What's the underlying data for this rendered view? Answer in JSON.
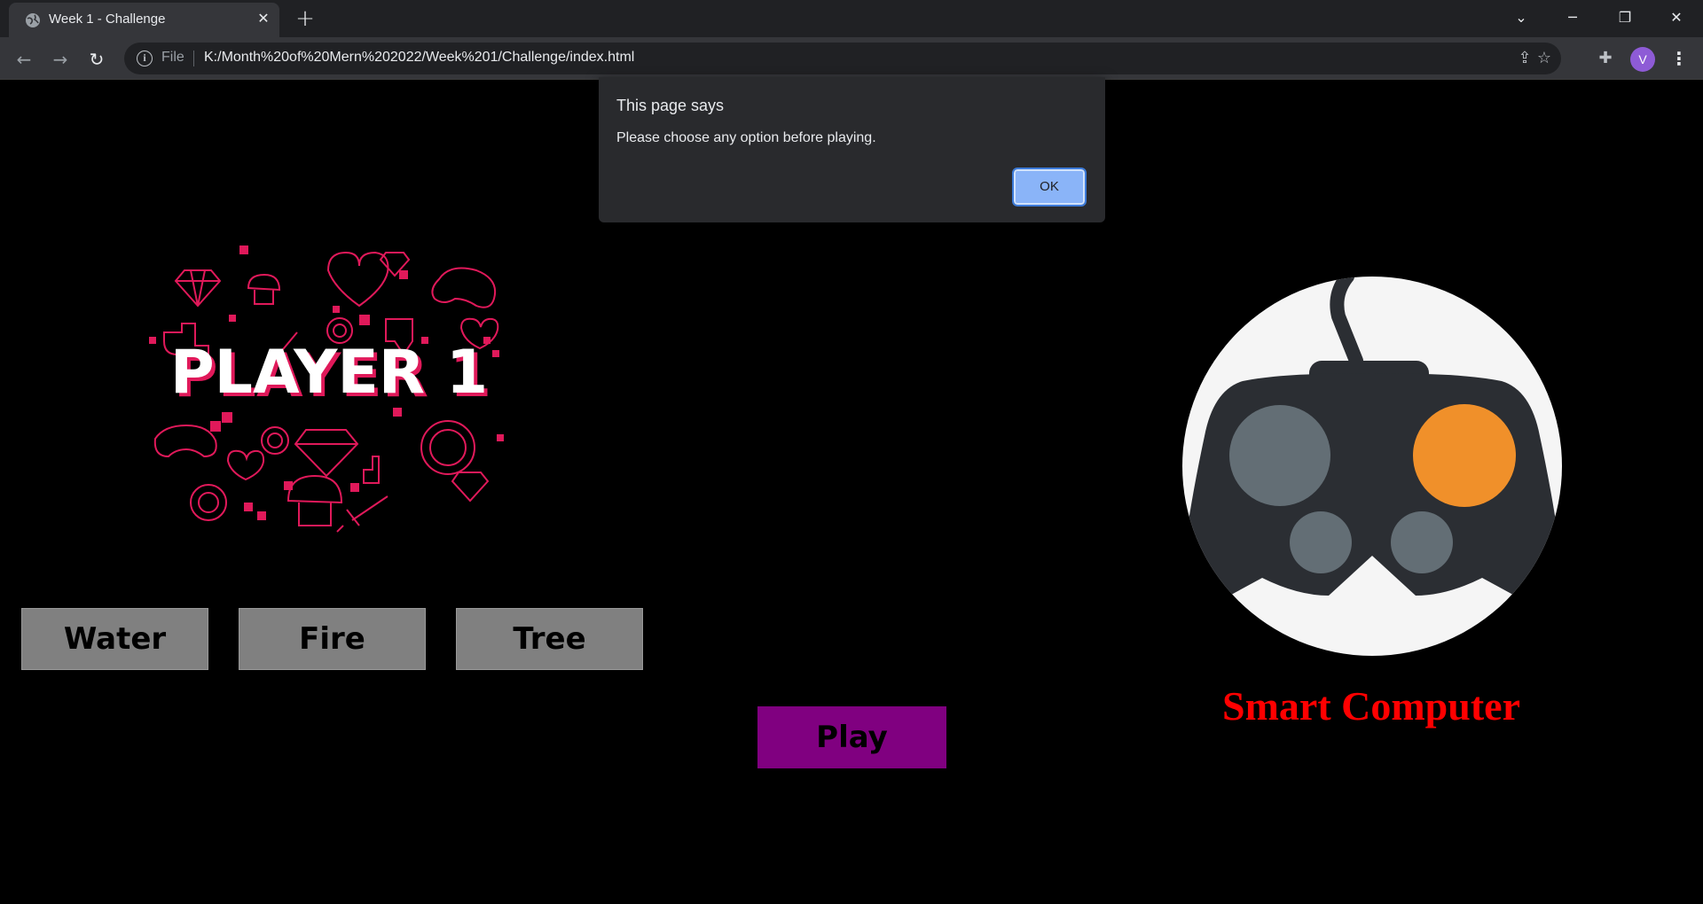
{
  "browser": {
    "tab_title": "Week 1 - Challenge",
    "new_tab_symbol": "+",
    "file_label": "File",
    "url": "K:/Month%20of%20Mern%202022/Week%201/Challenge/index.html",
    "profile_initial": "V"
  },
  "page": {
    "player_title": "PLAYER 1",
    "choices": [
      "Water",
      "Fire",
      "Tree"
    ],
    "play_label": "Play",
    "computer_label": "Smart Computer",
    "colors": {
      "background": "#000000",
      "choice_button": "#808080",
      "play_button": "#800080",
      "computer_label": "#ff0000",
      "controller_accent": "#f0902a"
    }
  },
  "dialog": {
    "title": "This page says",
    "message": "Please choose any option before playing.",
    "ok_label": "OK"
  }
}
